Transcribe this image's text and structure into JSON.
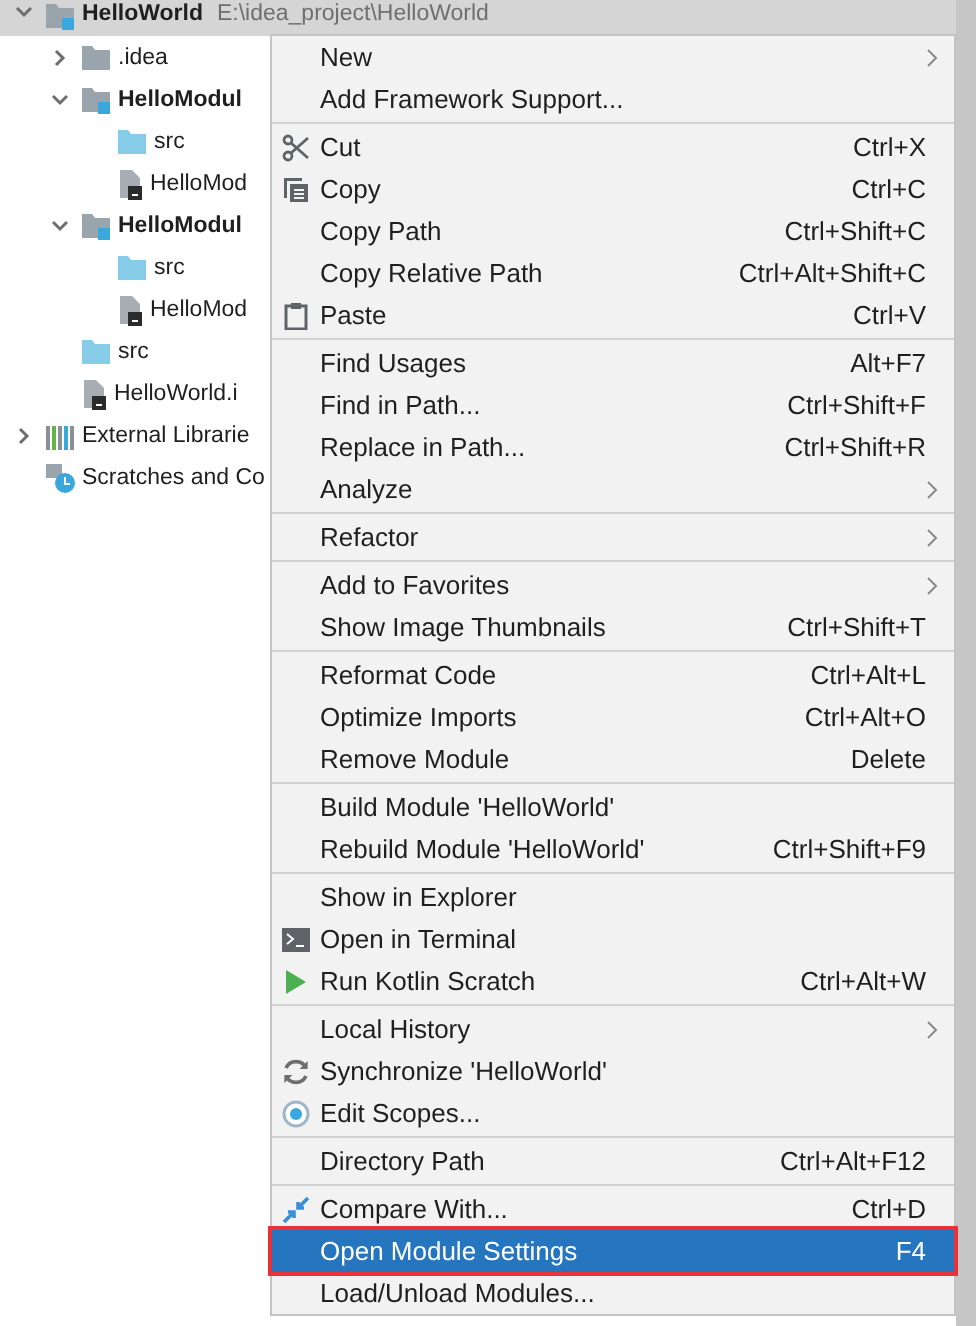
{
  "project_tree": [
    {
      "label": "HelloWorld",
      "path": "E:\\idea_project\\HelloWorld",
      "kind": "project",
      "expanded": true,
      "selected": true,
      "children": [
        {
          "label": ".idea",
          "kind": "folder",
          "expanded": false,
          "selected": false
        },
        {
          "label": "HelloModul",
          "kind": "module",
          "expanded": true,
          "selected": false,
          "children": [
            {
              "label": "src",
              "kind": "source",
              "selected": false
            },
            {
              "label": "HelloMod",
              "kind": "file",
              "selected": false
            }
          ]
        },
        {
          "label": "HelloModul",
          "kind": "module",
          "expanded": true,
          "selected": false,
          "children": [
            {
              "label": "src",
              "kind": "source",
              "selected": false
            },
            {
              "label": "HelloMod",
              "kind": "file",
              "selected": false
            }
          ]
        },
        {
          "label": "src",
          "kind": "source",
          "selected": false
        },
        {
          "label": "HelloWorld.i",
          "kind": "file",
          "selected": false
        }
      ]
    },
    {
      "label": "External Librarie",
      "kind": "libraries",
      "expanded": false,
      "selected": false
    },
    {
      "label": "Scratches and Co",
      "kind": "scratches",
      "selected": false
    }
  ],
  "context_menu": {
    "groups": [
      [
        {
          "label": "New",
          "submenu": true,
          "selected": false
        },
        {
          "label": "Add Framework Support...",
          "submenu": false,
          "selected": false
        }
      ],
      [
        {
          "label": "Cut",
          "shortcut": "Ctrl+X",
          "submenu": false,
          "selected": false
        },
        {
          "label": "Copy",
          "shortcut": "Ctrl+C",
          "submenu": false,
          "selected": false
        },
        {
          "label": "Copy Path",
          "shortcut": "Ctrl+Shift+C",
          "submenu": false,
          "selected": false
        },
        {
          "label": "Copy Relative Path",
          "shortcut": "Ctrl+Alt+Shift+C",
          "submenu": false,
          "selected": false
        },
        {
          "label": "Paste",
          "shortcut": "Ctrl+V",
          "submenu": false,
          "selected": false
        }
      ],
      [
        {
          "label": "Find Usages",
          "shortcut": "Alt+F7",
          "submenu": false,
          "selected": false
        },
        {
          "label": "Find in Path...",
          "shortcut": "Ctrl+Shift+F",
          "submenu": false,
          "selected": false
        },
        {
          "label": "Replace in Path...",
          "shortcut": "Ctrl+Shift+R",
          "submenu": false,
          "selected": false
        },
        {
          "label": "Analyze",
          "submenu": true,
          "selected": false
        }
      ],
      [
        {
          "label": "Refactor",
          "submenu": true,
          "selected": false
        }
      ],
      [
        {
          "label": "Add to Favorites",
          "submenu": true,
          "selected": false
        },
        {
          "label": "Show Image Thumbnails",
          "shortcut": "Ctrl+Shift+T",
          "submenu": false,
          "selected": false
        }
      ],
      [
        {
          "label": "Reformat Code",
          "shortcut": "Ctrl+Alt+L",
          "submenu": false,
          "selected": false
        },
        {
          "label": "Optimize Imports",
          "shortcut": "Ctrl+Alt+O",
          "submenu": false,
          "selected": false
        },
        {
          "label": "Remove Module",
          "shortcut": "Delete",
          "submenu": false,
          "selected": false
        }
      ],
      [
        {
          "label": "Build Module 'HelloWorld'",
          "submenu": false,
          "selected": false
        },
        {
          "label": "Rebuild Module 'HelloWorld'",
          "shortcut": "Ctrl+Shift+F9",
          "submenu": false,
          "selected": false
        }
      ],
      [
        {
          "label": "Show in Explorer",
          "submenu": false,
          "selected": false
        },
        {
          "label": "Open in Terminal",
          "submenu": false,
          "selected": false
        },
        {
          "label": "Run Kotlin Scratch",
          "shortcut": "Ctrl+Alt+W",
          "submenu": false,
          "selected": false
        }
      ],
      [
        {
          "label": "Local History",
          "submenu": true,
          "selected": false
        },
        {
          "label": "Synchronize 'HelloWorld'",
          "submenu": false,
          "selected": false
        },
        {
          "label": "Edit Scopes...",
          "submenu": false,
          "selected": false
        }
      ],
      [
        {
          "label": "Directory Path",
          "shortcut": "Ctrl+Alt+F12",
          "submenu": false,
          "selected": false
        }
      ],
      [
        {
          "label": "Compare With...",
          "shortcut": "Ctrl+D",
          "submenu": false,
          "selected": false
        },
        {
          "label": "Open Module Settings",
          "shortcut": "F4",
          "submenu": false,
          "selected": true,
          "outlined": true
        },
        {
          "label": "Load/Unload Modules...",
          "submenu": false,
          "selected": false
        }
      ]
    ]
  }
}
